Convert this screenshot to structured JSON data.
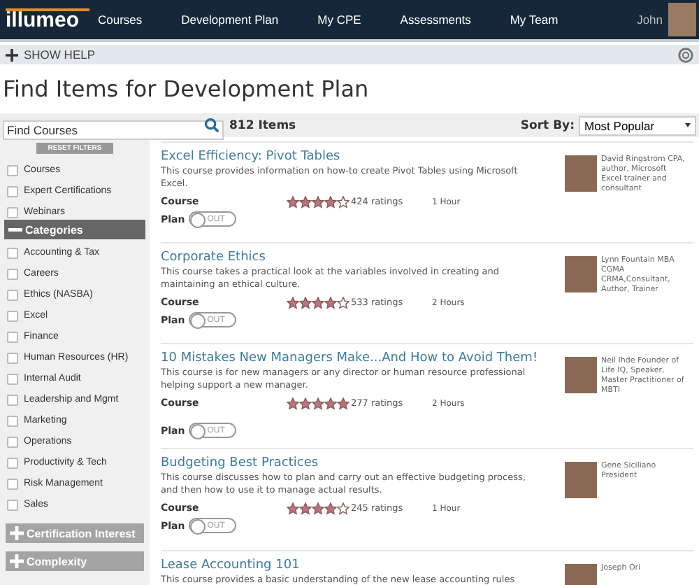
{
  "nav": {
    "logo": "illumeo",
    "items": [
      {
        "label": "Courses",
        "selected": false
      },
      {
        "label": "Development Plan",
        "selected": false
      },
      {
        "label": "My CPE",
        "selected": false
      },
      {
        "label": "Assessments",
        "selected": false
      },
      {
        "label": "My Team",
        "selected": false
      }
    ],
    "user": "John"
  },
  "help": {
    "label": "SHOW HELP"
  },
  "title": "Find Items for Development Plan",
  "search": {
    "placeholder": "Find Courses",
    "count": "812 Items",
    "sort_label": "Sort By:",
    "sort_value": "Most Popular"
  },
  "sidebar": {
    "reset": "RESET FILTERS",
    "types": [
      {
        "label": "Courses",
        "checked": false
      },
      {
        "label": "Expert Certifications",
        "checked": false
      },
      {
        "label": "Webinars",
        "checked": false
      }
    ],
    "sections": [
      {
        "label": "Categories",
        "expanded": true,
        "items": [
          {
            "label": "Accounting & Tax",
            "checked": false
          },
          {
            "label": "Careers",
            "checked": false
          },
          {
            "label": "Ethics (NASBA)",
            "checked": false
          },
          {
            "label": "Excel",
            "checked": false
          },
          {
            "label": "Finance",
            "checked": false
          },
          {
            "label": "Human Resources (HR)",
            "checked": false
          },
          {
            "label": "Internal Audit",
            "checked": false
          },
          {
            "label": "Leadership and Mgmt",
            "checked": false
          },
          {
            "label": "Marketing",
            "checked": false
          },
          {
            "label": "Operations",
            "checked": false
          },
          {
            "label": "Productivity & Tech",
            "checked": false
          },
          {
            "label": "Risk Management",
            "checked": false
          },
          {
            "label": "Sales",
            "checked": false
          }
        ]
      },
      {
        "label": "Certification Interest",
        "expanded": false
      },
      {
        "label": "Complexity",
        "expanded": false
      }
    ]
  },
  "courses": [
    {
      "title": "Excel Efficiency: Pivot Tables",
      "description": "This course provides information on how-to create Pivot Tables using Microsoft Excel.",
      "type": "Course",
      "stars": 4,
      "ratings": "424 ratings",
      "duration": "1 Hour",
      "plan": {
        "label": "Plan",
        "toggle": "OUT",
        "on": false
      },
      "instructor": "David Ringstrom CPA, author, Microsoft Excel trainer and consultant"
    },
    {
      "title": "Corporate Ethics",
      "description": "This course takes a practical look at the variables involved in creating and maintaining an ethical culture.",
      "type": "Course",
      "stars": 4,
      "ratings": "533 ratings",
      "duration": "2 Hours",
      "plan": {
        "label": "Plan",
        "toggle": "OUT",
        "on": false
      },
      "instructor": "Lynn Fountain MBA CGMA CRMA,Consultant, Author, Trainer"
    },
    {
      "title": "10 Mistakes New Managers Make...And How to Avoid Them!",
      "description": "This course is for new managers or any director or human resource professional helping support a new manager.",
      "type": "Course",
      "stars": 5,
      "ratings": "277 ratings",
      "duration": "2 Hours",
      "plan": {
        "label": "Plan",
        "toggle": "OUT",
        "on": false
      },
      "instructor": "Neil Ihde Founder of Life IQ, Speaker, Master Practitioner of MBTI"
    },
    {
      "title": "Budgeting Best Practices",
      "description": "This course discusses how to plan and carry out an effective budgeting process, and then how to use it to manage actual results.",
      "type": "Course",
      "stars": 4,
      "ratings": "245 ratings",
      "duration": "1 Hour",
      "plan": {
        "label": "Plan",
        "toggle": "OUT",
        "on": false
      },
      "instructor": "Gene Siciliano President"
    },
    {
      "title": "Lease Accounting 101",
      "description": "This course provides a basic understanding of the new lease accounting rules",
      "instructor": "Joseph Ori"
    }
  ]
}
